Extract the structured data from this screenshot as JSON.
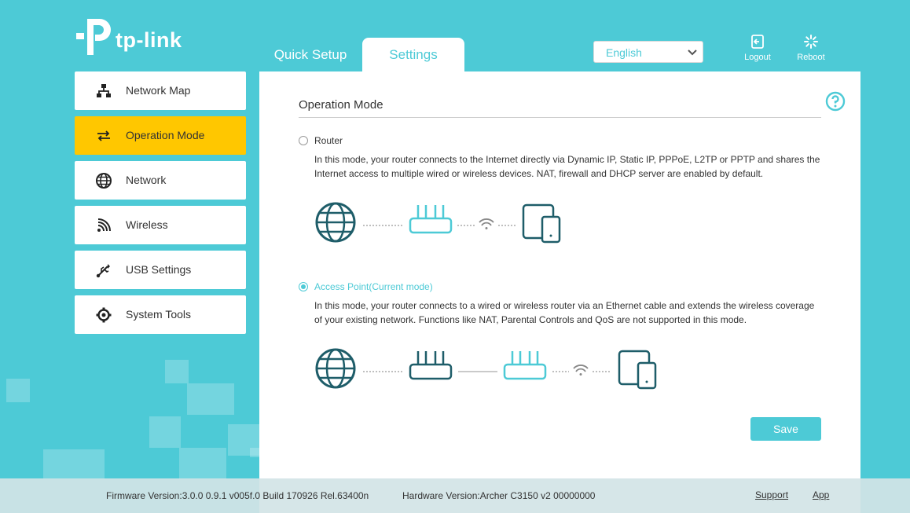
{
  "header": {
    "logo_text": "tp-link",
    "tabs": [
      {
        "label": "Quick Setup"
      },
      {
        "label": "Settings"
      }
    ],
    "language": "English",
    "logout_label": "Logout",
    "reboot_label": "Reboot"
  },
  "sidebar": {
    "items": [
      {
        "label": "Network Map",
        "icon": "network-map-icon"
      },
      {
        "label": "Operation Mode",
        "icon": "operation-mode-icon",
        "active": true
      },
      {
        "label": "Network",
        "icon": "globe-icon"
      },
      {
        "label": "Wireless",
        "icon": "wireless-icon"
      },
      {
        "label": "USB Settings",
        "icon": "usb-icon"
      },
      {
        "label": "System Tools",
        "icon": "gear-icon"
      }
    ]
  },
  "main": {
    "section_title": "Operation Mode",
    "options": [
      {
        "label": "Router",
        "selected": false,
        "description_line1": "In this mode, your router connects to the Internet directly via Dynamic IP, Static IP, PPPoE, L2TP or PPTP and shares the",
        "description_line2": "Internet access to multiple wired or wireless devices. NAT, firewall and DHCP server are enabled by default."
      },
      {
        "label": "Access Point(Current mode)",
        "selected": true,
        "description_line1": "In this mode, your router connects to a wired or wireless router via an Ethernet cable and extends the wireless coverage",
        "description_line2": "of your existing network. Functions like NAT, Parental Controls and QoS are not supported in this mode."
      }
    ],
    "save_label": "Save"
  },
  "footer": {
    "firmware": "Firmware Version:3.0.0 0.9.1 v005f.0 Build 170926 Rel.63400n",
    "hardware": "Hardware Version:Archer C3150 v2 00000000",
    "support_label": "Support",
    "app_label": "App"
  },
  "colors": {
    "background": "#4dcad6",
    "accent": "#4dcad6",
    "active_item": "#ffc700",
    "icon_dark": "#1e5d69"
  }
}
